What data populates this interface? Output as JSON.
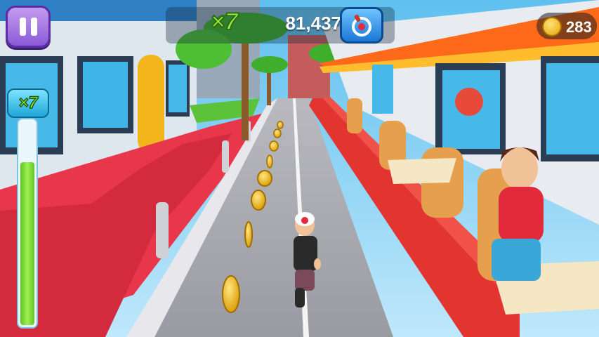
{
  "hud": {
    "multiplier_top": "×7",
    "score": "81,437",
    "coins": "283",
    "meter_multiplier": "×7",
    "meter_level": 0.8
  },
  "icons": [
    "pause-icon",
    "magnet-powerup-icon",
    "coin-star-icon"
  ]
}
